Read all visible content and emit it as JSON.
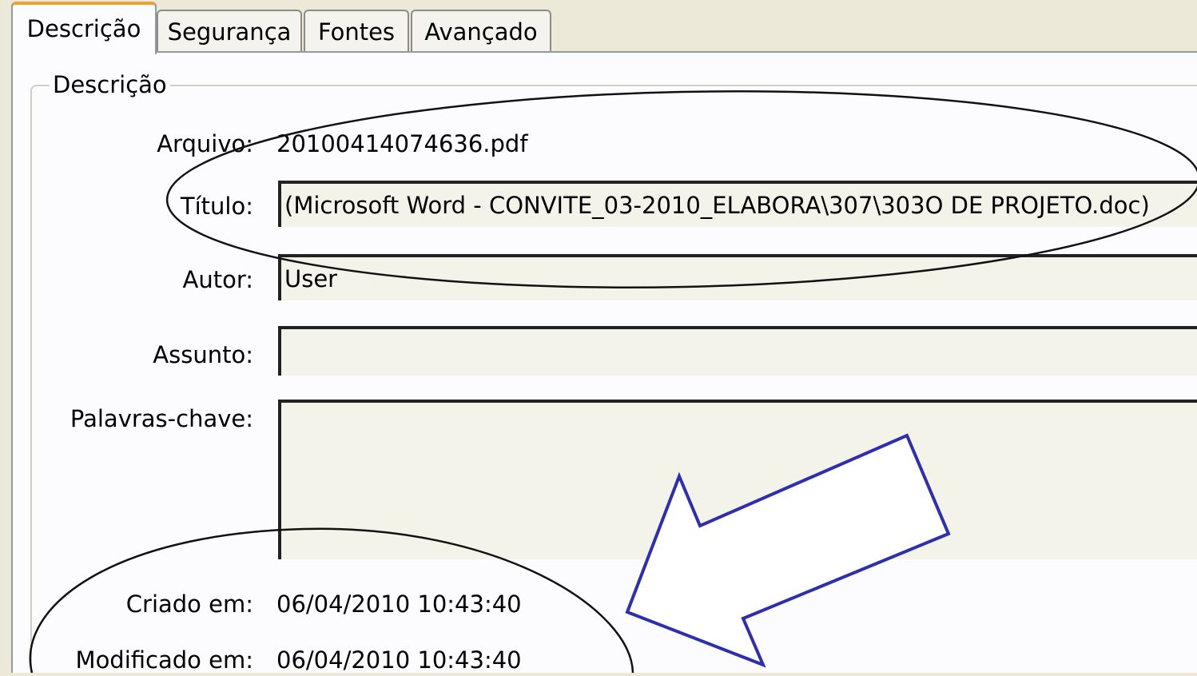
{
  "tabs": [
    {
      "label": "Descrição",
      "active": true
    },
    {
      "label": "Segurança",
      "active": false
    },
    {
      "label": "Fontes",
      "active": false
    },
    {
      "label": "Avançado",
      "active": false
    }
  ],
  "group": {
    "legend": "Descrição"
  },
  "fields": {
    "arquivo": {
      "label": "Arquivo:",
      "value": "20100414074636.pdf"
    },
    "titulo": {
      "label": "Título:",
      "value": "(Microsoft Word - CONVITE_03-2010_ELABORA\\307\\303O DE PROJETO.doc)"
    },
    "autor": {
      "label": "Autor:",
      "value": "User"
    },
    "assunto": {
      "label": "Assunto:",
      "value": ""
    },
    "palavras_chave": {
      "label": "Palavras-chave:",
      "value": ""
    },
    "criado_em": {
      "label": "Criado em:",
      "value": "06/04/2010 10:43:40"
    },
    "modificado_em": {
      "label": "Modificado em:",
      "value": "06/04/2010 10:43:40"
    }
  },
  "colors": {
    "dialog_bg": "#ece9d8",
    "panel_bg": "#fcfcfe",
    "field_bg": "#f4f3ea",
    "tab_highlight": "#f0a030",
    "annotation_arrow": "#2e2eb0",
    "annotation_ellipse": "#111111"
  },
  "annotations": {
    "arrow_icon": "arrow-down-left-icon",
    "ellipse": "highlight-ellipse"
  }
}
